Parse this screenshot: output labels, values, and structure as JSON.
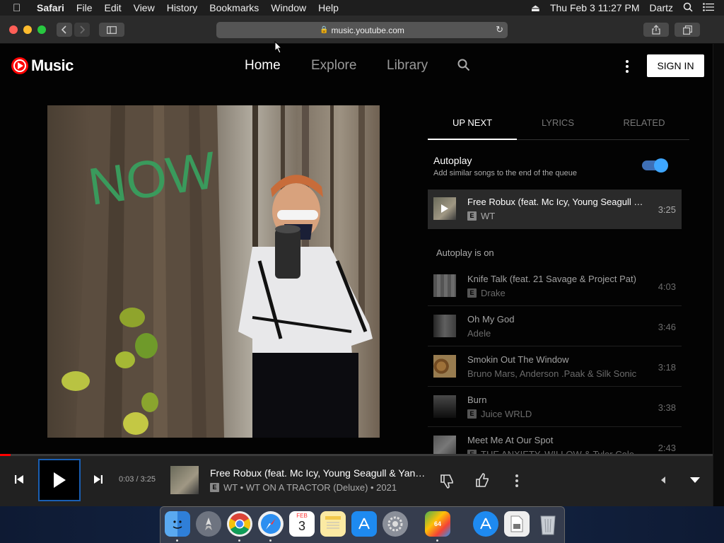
{
  "menubar": {
    "apple_icon": "apple-icon",
    "items": [
      "Safari",
      "File",
      "Edit",
      "View",
      "History",
      "Bookmarks",
      "Window",
      "Help"
    ],
    "clock": "Thu Feb 3  11:27 PM",
    "user": "Dartz"
  },
  "browser": {
    "url": "music.youtube.com"
  },
  "header": {
    "logo_text": "Music",
    "nav": [
      "Home",
      "Explore",
      "Library"
    ],
    "active_nav": "Home",
    "signin_label": "SIGN IN"
  },
  "album_art": {
    "graffiti": "NOW"
  },
  "side_panel": {
    "tabs": [
      "UP NEXT",
      "LYRICS",
      "RELATED"
    ],
    "active_tab": "UP NEXT",
    "autoplay_title": "Autoplay",
    "autoplay_desc": "Add similar songs to the end of the queue",
    "autoplay_enabled": true,
    "autoplay_on_label": "Autoplay is on",
    "current": {
      "title": "Free Robux (feat. Mc Icy, Young Seagull & Yang...)",
      "artist": "WT",
      "explicit": true,
      "duration": "3:25"
    },
    "queue": [
      {
        "title": "Knife Talk (feat. 21 Savage & Project Pat)",
        "artist": "Drake",
        "explicit": true,
        "duration": "4:03"
      },
      {
        "title": "Oh My God",
        "artist": "Adele",
        "explicit": false,
        "duration": "3:46"
      },
      {
        "title": "Smokin Out The Window",
        "artist": "Bruno Mars, Anderson .Paak & Silk Sonic",
        "explicit": false,
        "duration": "3:18"
      },
      {
        "title": "Burn",
        "artist": "Juice WRLD",
        "explicit": true,
        "duration": "3:38"
      },
      {
        "title": "Meet Me At Our Spot",
        "artist": "THE ANXIETY, WILLOW & Tyler Cole",
        "explicit": true,
        "duration": "2:43"
      }
    ],
    "explicit_badge": "E"
  },
  "player": {
    "time": "0:03 / 3:25",
    "progress_fraction": 0.015,
    "title": "Free Robux (feat. Mc Icy, Young Seagull & Yang...",
    "subtitle": "WT • WT ON A TRACTOR (Deluxe) • 2021",
    "explicit": true
  },
  "dock": {
    "apps": [
      "Finder",
      "Launchpad",
      "Chrome",
      "Safari",
      "Calendar",
      "Notes",
      "App Store",
      "System Preferences",
      "BlueStacks",
      "App Store Downloads",
      "Preview",
      "Trash"
    ],
    "calendar_month": "FEB",
    "calendar_day": "3"
  },
  "colors": {
    "accent_red": "#ff0000",
    "toggle_blue": "#3ea6ff"
  }
}
